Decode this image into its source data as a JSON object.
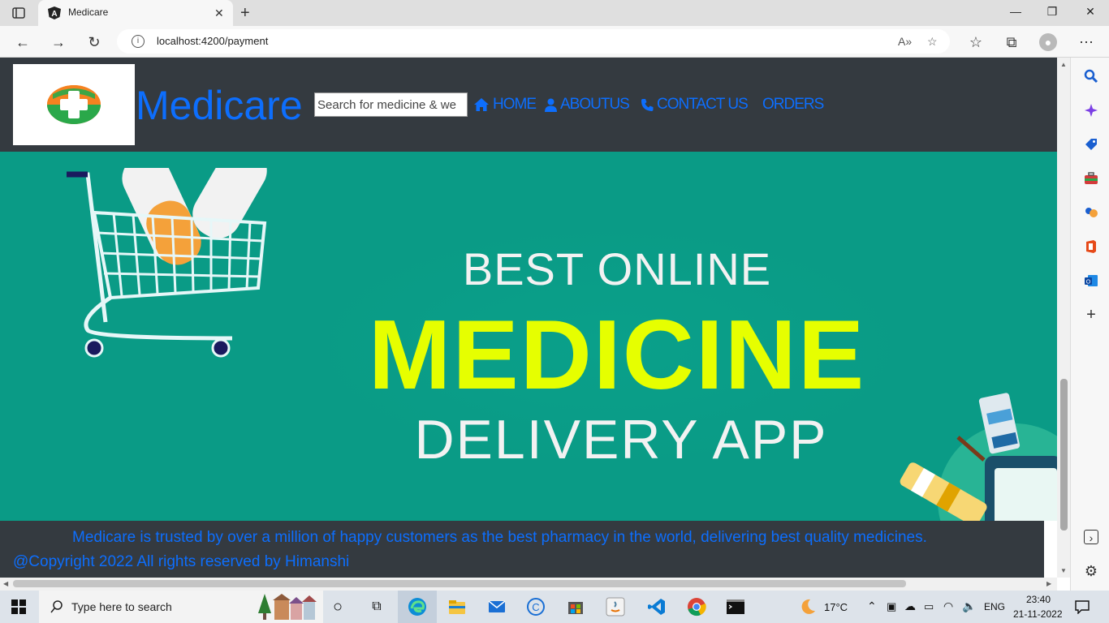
{
  "browser": {
    "tab_title": "Medicare",
    "url": "localhost:4200/payment"
  },
  "site": {
    "brand": "Medicare",
    "search_placeholder": "Search for medicine & we",
    "menu": {
      "home": "HOME",
      "about": "ABOUTUS",
      "contact": "CONTACT US",
      "orders": "ORDERS"
    },
    "banner": {
      "line1": "BEST ONLINE",
      "line2": "MEDICINE",
      "line3": "DELIVERY APP"
    },
    "footer": {
      "tagline": "Medicare is trusted by over a million of happy customers as the best pharmacy in the world, delivering best quality medicines.",
      "copyright": "@Copyright 2022 All rights reserved by Himanshi"
    }
  },
  "taskbar": {
    "search_text": "Type here to search",
    "weather": "17°C",
    "lang": "ENG",
    "time": "23:40",
    "date": "21-11-2022"
  },
  "colors": {
    "header_bg": "#343a40",
    "link": "#0d6efd",
    "banner_bg": "#0a9b86",
    "banner_accent": "#e6ff00"
  }
}
